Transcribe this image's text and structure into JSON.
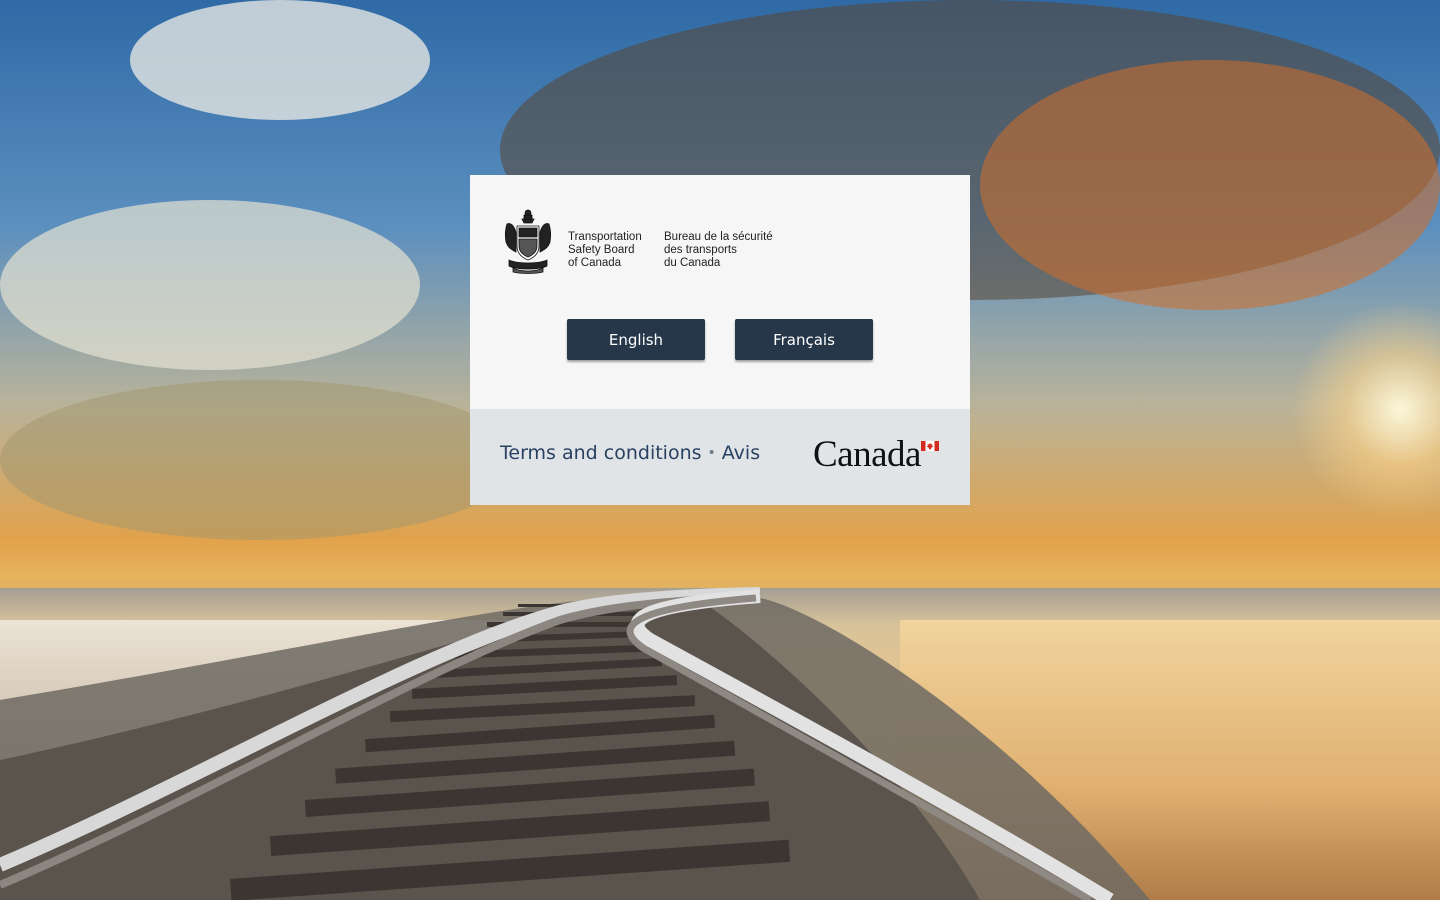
{
  "background": {
    "scene": "railway-sunset",
    "accent": "#e1a24b"
  },
  "signature": {
    "en_lines": [
      "Transportation",
      "Safety Board",
      "of Canada"
    ],
    "fr_lines": [
      "Bureau de la sécurité",
      "des transports",
      "du Canada"
    ],
    "icon": "coat-of-arms-icon"
  },
  "buttons": {
    "english": "English",
    "french": "Français",
    "color": "#26374a"
  },
  "footer": {
    "terms_label": "Terms and conditions",
    "separator": "•",
    "avis_label": "Avis",
    "wordmark": "Canada",
    "link_color": "#284162",
    "flag_icon": "canada-flag-icon"
  }
}
